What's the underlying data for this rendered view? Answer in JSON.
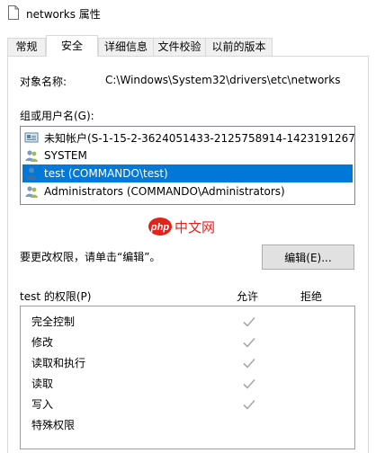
{
  "window": {
    "title": "networks 属性"
  },
  "tabs": [
    {
      "label": "常规"
    },
    {
      "label": "安全"
    },
    {
      "label": "详细信息"
    },
    {
      "label": "文件校验"
    },
    {
      "label": "以前的版本"
    }
  ],
  "object": {
    "label": "对象名称:",
    "value": "C:\\Windows\\System32\\drivers\\etc\\networks"
  },
  "groups": {
    "label": "组或用户名(G):",
    "items": [
      {
        "name": "未知帐户(S-1-15-2-3624051433-2125758914-1423191267-...",
        "icon": "unknown-account-icon"
      },
      {
        "name": "SYSTEM",
        "icon": "user-group-icon"
      },
      {
        "name": "test (COMMANDO\\test)",
        "icon": "user-icon"
      },
      {
        "name": "Administrators (COMMANDO\\Administrators)",
        "icon": "user-group-icon"
      }
    ],
    "selected_index": 2
  },
  "change": {
    "text": "要更改权限，请单击“编辑”。",
    "button": "编辑(E)..."
  },
  "permissions": {
    "title": "test 的权限(P)",
    "allow_header": "允许",
    "deny_header": "拒绝",
    "rows": [
      {
        "name": "完全控制",
        "allow": true,
        "deny": false
      },
      {
        "name": "修改",
        "allow": true,
        "deny": false
      },
      {
        "name": "读取和执行",
        "allow": true,
        "deny": false
      },
      {
        "name": "读取",
        "allow": true,
        "deny": false
      },
      {
        "name": "写入",
        "allow": true,
        "deny": false
      },
      {
        "name": "特殊权限",
        "allow": false,
        "deny": false
      }
    ]
  },
  "watermark": {
    "php": "php",
    "text": "中文网"
  },
  "colors": {
    "selection": "#0078d7",
    "check": "#a8a8a8",
    "watermark_red": "#e2231a"
  }
}
